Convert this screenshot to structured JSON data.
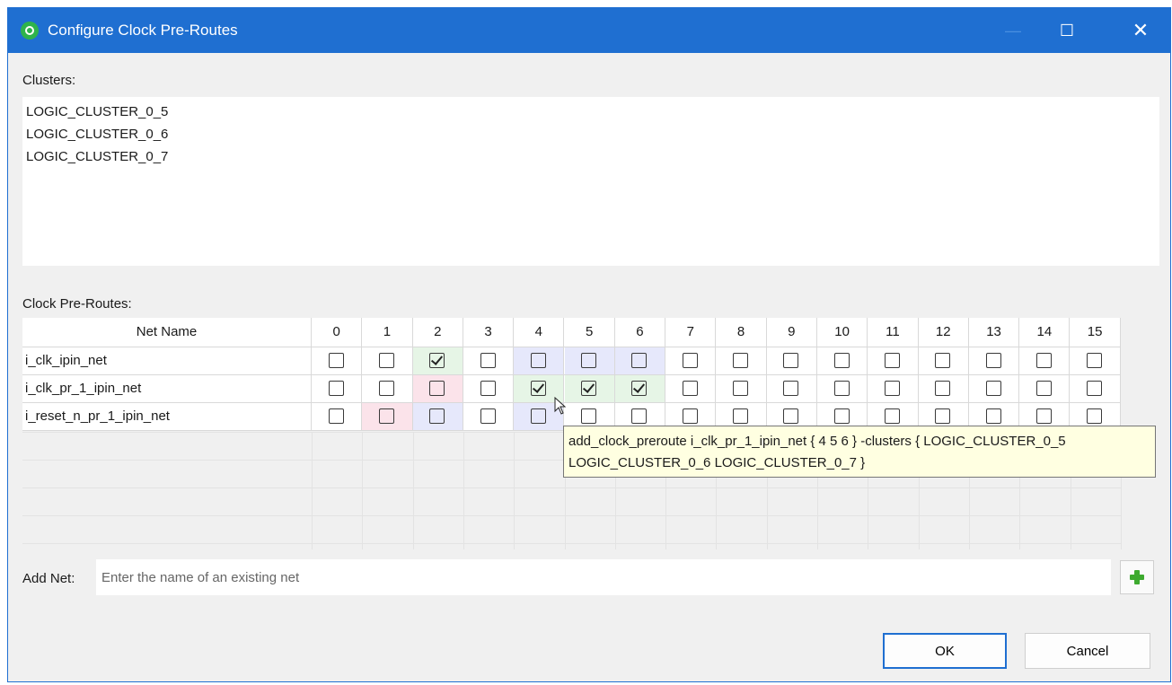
{
  "window": {
    "title": "Configure Clock Pre-Routes",
    "accent_color": "#1f6fd1",
    "icon": "app-logo-icon"
  },
  "clusters": {
    "label": "Clusters:",
    "items": [
      "LOGIC_CLUSTER_0_5",
      "LOGIC_CLUSTER_0_6",
      "LOGIC_CLUSTER_0_7"
    ]
  },
  "preroutes": {
    "label": "Clock Pre-Routes:",
    "net_header": "Net Name",
    "columns": [
      "0",
      "1",
      "2",
      "3",
      "4",
      "5",
      "6",
      "7",
      "8",
      "9",
      "10",
      "11",
      "12",
      "13",
      "14",
      "15"
    ],
    "rows": [
      {
        "name": "i_clk_ipin_net",
        "checked": [
          2
        ],
        "green": [
          2
        ],
        "pink": [],
        "blue": [
          4,
          5,
          6
        ]
      },
      {
        "name": "i_clk_pr_1_ipin_net",
        "checked": [
          4,
          5,
          6
        ],
        "green": [
          4,
          5,
          6
        ],
        "pink": [
          2
        ],
        "blue": []
      },
      {
        "name": "i_reset_n_pr_1_ipin_net",
        "checked": [],
        "green": [],
        "pink": [
          1
        ],
        "blue": [
          2,
          4
        ]
      }
    ],
    "highlight_colors": {
      "green": "#e6f5e6",
      "pink": "#fbe3ea",
      "blue": "#e6e8fb"
    }
  },
  "tooltip": {
    "line1": "add_clock_preroute i_clk_pr_1_ipin_net { 4 5 6 } -clusters { LOGIC_CLUSTER_0_5",
    "line2": "LOGIC_CLUSTER_0_6 LOGIC_CLUSTER_0_7 }"
  },
  "add_net": {
    "label": "Add Net:",
    "placeholder": "Enter the name of an existing net",
    "button_icon": "plus-icon"
  },
  "buttons": {
    "ok": "OK",
    "cancel": "Cancel"
  }
}
